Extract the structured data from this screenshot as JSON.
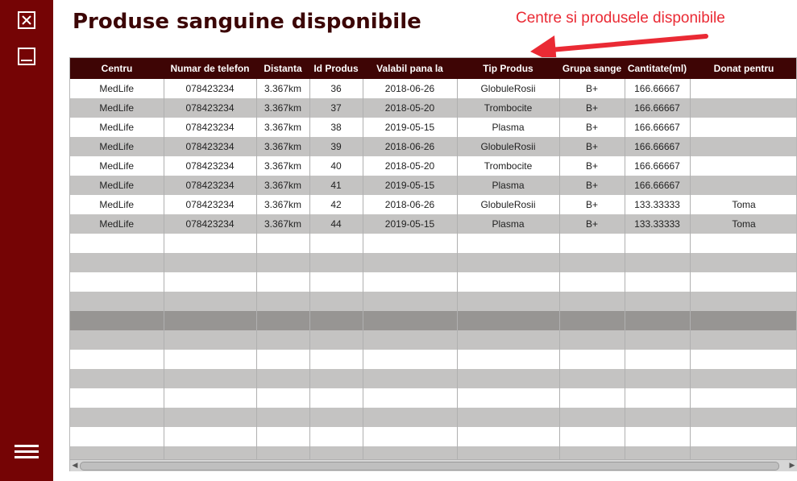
{
  "page": {
    "title": "Produse sanguine disponibile"
  },
  "annotation": {
    "text": "Centre si produsele disponibile",
    "color": "#ea2a34"
  },
  "sidebar": {
    "icons": [
      "close-icon",
      "minimize-icon",
      "menu-icon"
    ],
    "color": "#750405"
  },
  "table": {
    "columns": [
      "Centru",
      "Numar de telefon",
      "Distanta",
      "Id Produs",
      "Valabil pana la",
      "Tip Produs",
      "Grupa sange",
      "Cantitate(ml)",
      "Donat pentru"
    ],
    "rows": [
      [
        "MedLife",
        "078423234",
        "3.367km",
        "36",
        "2018-06-26",
        "GlobuleRosii",
        "B+",
        "166.66667",
        ""
      ],
      [
        "MedLife",
        "078423234",
        "3.367km",
        "37",
        "2018-05-20",
        "Trombocite",
        "B+",
        "166.66667",
        ""
      ],
      [
        "MedLife",
        "078423234",
        "3.367km",
        "38",
        "2019-05-15",
        "Plasma",
        "B+",
        "166.66667",
        ""
      ],
      [
        "MedLife",
        "078423234",
        "3.367km",
        "39",
        "2018-06-26",
        "GlobuleRosii",
        "B+",
        "166.66667",
        ""
      ],
      [
        "MedLife",
        "078423234",
        "3.367km",
        "40",
        "2018-05-20",
        "Trombocite",
        "B+",
        "166.66667",
        ""
      ],
      [
        "MedLife",
        "078423234",
        "3.367km",
        "41",
        "2019-05-15",
        "Plasma",
        "B+",
        "166.66667",
        ""
      ],
      [
        "MedLife",
        "078423234",
        "3.367km",
        "42",
        "2018-06-26",
        "GlobuleRosii",
        "B+",
        "133.33333",
        "Toma"
      ],
      [
        "MedLife",
        "078423234",
        "3.367km",
        "44",
        "2019-05-15",
        "Plasma",
        "B+",
        "133.33333",
        "Toma"
      ]
    ],
    "header_color": "#3e0505"
  }
}
